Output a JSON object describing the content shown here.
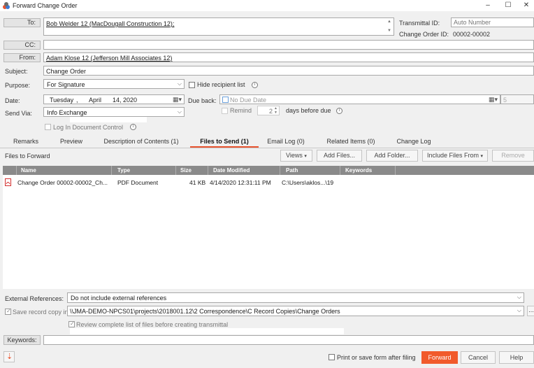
{
  "window": {
    "title": "Forward Change Order",
    "minimize": "–",
    "maximize": "☐",
    "close": "✕"
  },
  "header": {
    "to_label": "To:",
    "to_value": "Bob Welder 12 (MacDougall Construction 12);",
    "cc_label": "CC:",
    "from_label": "From:",
    "from_value": "Adam Klose 12 (Jefferson Mill Associates 12)",
    "transmittal_label": "Transmittal ID:",
    "transmittal_placeholder": "Auto Number",
    "change_order_label": "Change Order ID:",
    "change_order_value": "00002-00002",
    "subject_label": "Subject:",
    "subject_value": "Change Order",
    "purpose_label": "Purpose:",
    "purpose_value": "For Signature",
    "hide_recipient_label": "Hide recipient list",
    "date_label": "Date:",
    "date_day": "Tuesday",
    "date_sep": ",",
    "date_month": "April",
    "date_daynum": "14, 2020",
    "due_back_label": "Due back:",
    "due_back_placeholder": "No Due Date",
    "due_days": "5",
    "remind_label": "Remind",
    "remind_value": "2",
    "days_before_label": "days before due",
    "send_via_label": "Send Via:",
    "send_via_value": "Info Exchange",
    "log_in_doc_label": "Log In Document Control"
  },
  "tabs": [
    {
      "label": "Remarks"
    },
    {
      "label": "Preview"
    },
    {
      "label": "Description of Contents (1)"
    },
    {
      "label": "Files to Send (1)"
    },
    {
      "label": "Email Log (0)"
    },
    {
      "label": "Related Items (0)"
    },
    {
      "label": "Change Log"
    }
  ],
  "files_panel": {
    "title": "Files to Forward",
    "views_label": "Views",
    "add_files_label": "Add Files...",
    "add_folder_label": "Add Folder...",
    "include_files_label": "Include Files From",
    "remove_label": "Remove"
  },
  "table": {
    "columns": [
      "Name",
      "Type",
      "Size",
      "Date Modified",
      "Path",
      "Keywords"
    ],
    "rows": [
      {
        "name": "Change Order 00002-00002_Ch...",
        "type": "PDF Document",
        "size": "41 KB",
        "date": "4/14/2020 12:31:11 PM",
        "path": "C:\\Users\\aklos...\\19",
        "keywords": ""
      }
    ]
  },
  "footer": {
    "ext_ref_label": "External References:",
    "ext_ref_value": "Do not include external references",
    "save_record_label": "Save record copy in:",
    "save_record_value": "\\\\JMA-DEMO-NPCS01\\projects\\2018001.12\\2 Correspondence\\C Record Copies\\Change Orders",
    "browse_label": "...",
    "review_label": "Review complete list of files before creating transmittal",
    "keywords_label": "Keywords:",
    "print_save_label": "Print or save form after filing",
    "forward_label": "Forward",
    "cancel_label": "Cancel",
    "help_label": "Help"
  },
  "colors": {
    "accent": "#f15a2b",
    "grid_header": "#8a8a8a"
  }
}
